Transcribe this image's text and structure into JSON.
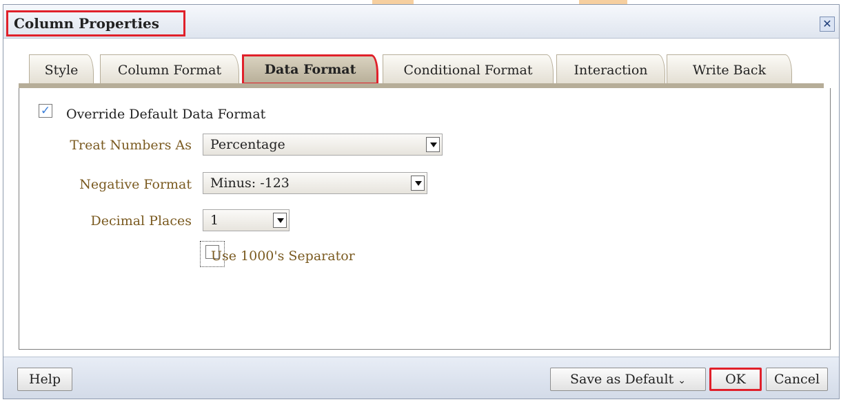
{
  "dialog": {
    "title": "Column Properties",
    "close_icon": "close-icon",
    "tabs": [
      {
        "label": "Style",
        "active": false
      },
      {
        "label": "Column Format",
        "active": false
      },
      {
        "label": "Data Format",
        "active": true
      },
      {
        "label": "Conditional Format",
        "active": false
      },
      {
        "label": "Interaction",
        "active": false
      },
      {
        "label": "Write Back",
        "active": false
      }
    ]
  },
  "data_format": {
    "override": {
      "label": "Override Default Data Format",
      "checked": true
    },
    "treat_numbers_as": {
      "label": "Treat Numbers As",
      "value": "Percentage"
    },
    "negative_format": {
      "label": "Negative Format",
      "value": "Minus: -123"
    },
    "decimal_places": {
      "label": "Decimal Places",
      "value": "1"
    },
    "separator": {
      "label": "Use 1000's Separator",
      "checked": false
    }
  },
  "footer": {
    "help": "Help",
    "save_as_default": "Save as Default",
    "save_as_default_icon": "chevron-down-icon",
    "ok": "OK",
    "cancel": "Cancel"
  },
  "colors": {
    "highlight": "#e0202a",
    "field_label": "#7a5a20",
    "check": "#3a7ed8",
    "footer_bg": "#d3dbe8"
  }
}
